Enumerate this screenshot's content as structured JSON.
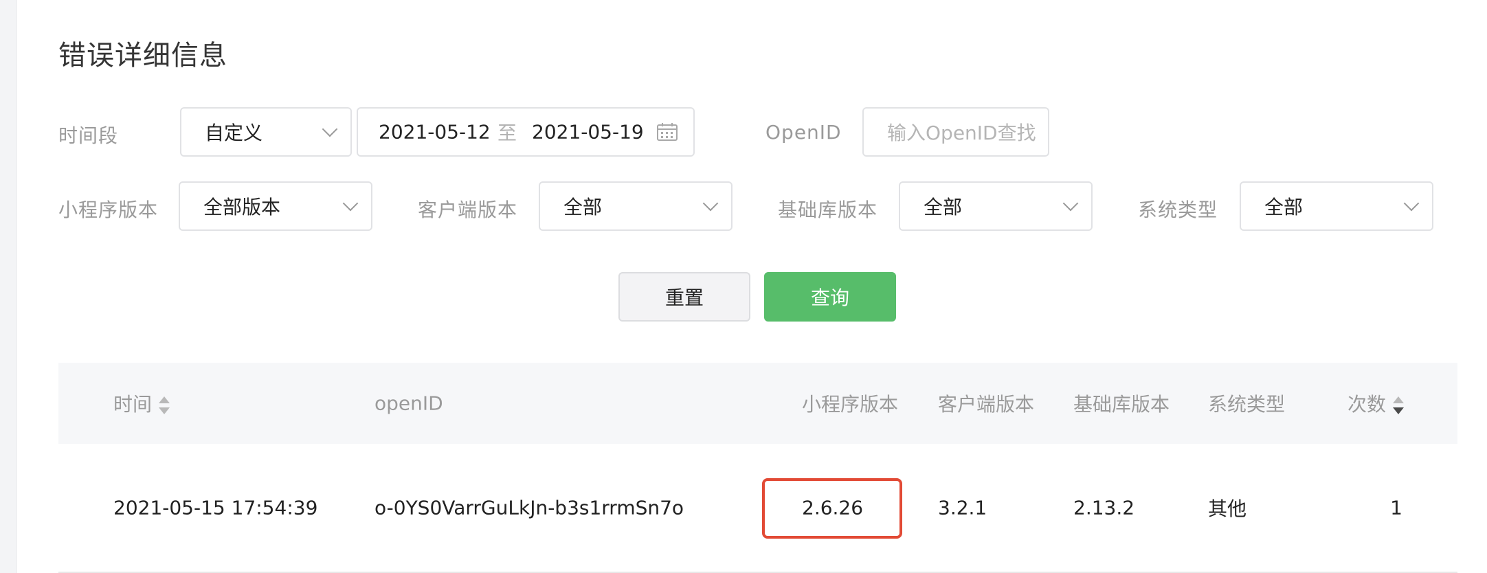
{
  "page": {
    "title": "错误详细信息"
  },
  "filters": {
    "time_range": {
      "label": "时间段",
      "value": "自定义"
    },
    "date_range": {
      "start": "2021-05-12",
      "separator": "至",
      "end": "2021-05-19"
    },
    "openid": {
      "label": "OpenID",
      "placeholder": "输入OpenID查找"
    },
    "miniprogram_version": {
      "label": "小程序版本",
      "value": "全部版本"
    },
    "client_version": {
      "label": "客户端版本",
      "value": "全部"
    },
    "base_library_version": {
      "label": "基础库版本",
      "value": "全部"
    },
    "system_type": {
      "label": "系统类型",
      "value": "全部"
    }
  },
  "actions": {
    "reset_label": "重置",
    "query_label": "查询"
  },
  "table": {
    "columns": {
      "time": "时间",
      "openid": "openID",
      "miniprogram_version": "小程序版本",
      "client_version": "客户端版本",
      "base_library_version": "基础库版本",
      "system_type": "系统类型",
      "count": "次数"
    },
    "rows": [
      {
        "time": "2021-05-15 17:54:39",
        "openid": "o-0YS0VarrGuLkJn-b3s1rrmSn7o",
        "miniprogram_version": "2.6.26",
        "client_version": "3.2.1",
        "base_library_version": "2.13.2",
        "system_type": "其他",
        "count": "1"
      }
    ]
  },
  "colors": {
    "accent_green": "#57bd6a",
    "highlight_red": "#e24a35"
  }
}
